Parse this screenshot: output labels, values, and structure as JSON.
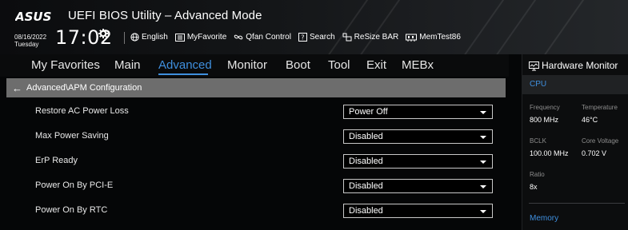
{
  "header": {
    "brand": "ASUS",
    "title": "UEFI BIOS Utility – Advanced Mode",
    "date": "08/16/2022",
    "day": "Tuesday",
    "time": "17:02",
    "tools": [
      {
        "icon": "globe-icon",
        "label": "English"
      },
      {
        "icon": "myfavorite-icon",
        "label": "MyFavorite"
      },
      {
        "icon": "fan-icon",
        "label": "Qfan Control"
      },
      {
        "icon": "search-icon",
        "label": "Search"
      },
      {
        "icon": "resize-bar-icon",
        "label": "ReSize BAR"
      },
      {
        "icon": "memtest-icon",
        "label": "MemTest86"
      }
    ]
  },
  "nav": {
    "tabs": [
      "My Favorites",
      "Main",
      "Advanced",
      "Monitor",
      "Boot",
      "Tool",
      "Exit",
      "MEBx"
    ],
    "active": "Advanced"
  },
  "breadcrumb": {
    "path": "Advanced\\APM Configuration"
  },
  "settings": [
    {
      "label": "Restore AC Power Loss",
      "value": "Power Off"
    },
    {
      "label": "Max Power Saving",
      "value": "Disabled"
    },
    {
      "label": "ErP Ready",
      "value": "Disabled"
    },
    {
      "label": "Power On By PCI-E",
      "value": "Disabled"
    },
    {
      "label": "Power On By RTC",
      "value": "Disabled"
    }
  ],
  "hardware_monitor": {
    "title": "Hardware Monitor",
    "cpu": {
      "section": "CPU",
      "frequency_label": "Frequency",
      "frequency": "800 MHz",
      "temperature_label": "Temperature",
      "temperature": "46°C",
      "bclk_label": "BCLK",
      "bclk": "100.00 MHz",
      "core_voltage_label": "Core Voltage",
      "core_voltage": "0.702 V",
      "ratio_label": "Ratio",
      "ratio": "8x"
    },
    "memory": {
      "section": "Memory"
    }
  },
  "colors": {
    "accent": "#3f8fde",
    "breadcrumb_bg": "#6d6d6d",
    "background": "#050607"
  }
}
